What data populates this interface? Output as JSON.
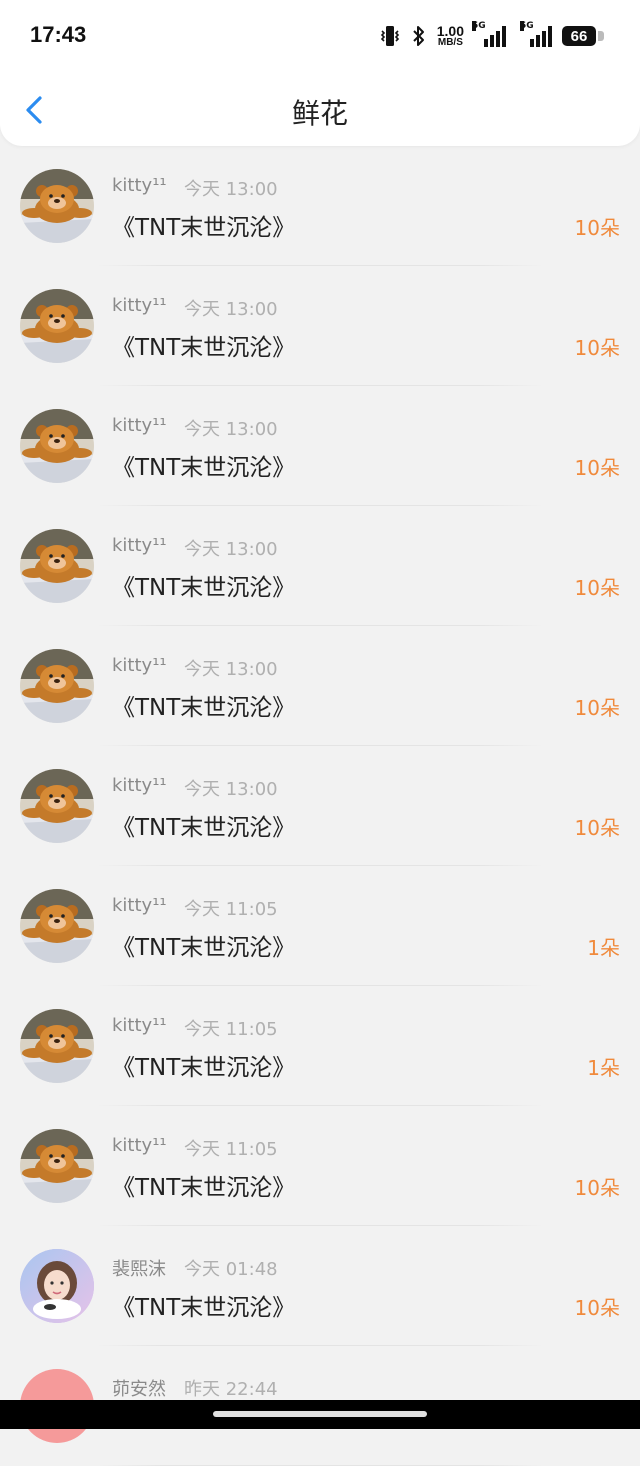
{
  "status_bar": {
    "time": "17:43",
    "speed_value": "1.00",
    "speed_unit": "MB/S",
    "net1": "5G",
    "net2": "5G",
    "battery": "66"
  },
  "header": {
    "title": "鲜花",
    "back_icon": "chevron-left-icon",
    "accent_color": "#2b8cf0"
  },
  "records": [
    {
      "name": "kitty¹¹",
      "time": "今天 13:00",
      "message": "《TNT末世沉沦》",
      "count": "10朵",
      "avatar": "bear"
    },
    {
      "name": "kitty¹¹",
      "time": "今天 13:00",
      "message": "《TNT末世沉沦》",
      "count": "10朵",
      "avatar": "bear"
    },
    {
      "name": "kitty¹¹",
      "time": "今天 13:00",
      "message": "《TNT末世沉沦》",
      "count": "10朵",
      "avatar": "bear"
    },
    {
      "name": "kitty¹¹",
      "time": "今天 13:00",
      "message": "《TNT末世沉沦》",
      "count": "10朵",
      "avatar": "bear"
    },
    {
      "name": "kitty¹¹",
      "time": "今天 13:00",
      "message": "《TNT末世沉沦》",
      "count": "10朵",
      "avatar": "bear"
    },
    {
      "name": "kitty¹¹",
      "time": "今天 13:00",
      "message": "《TNT末世沉沦》",
      "count": "10朵",
      "avatar": "bear"
    },
    {
      "name": "kitty¹¹",
      "time": "今天 11:05",
      "message": "《TNT末世沉沦》",
      "count": "1朵",
      "avatar": "bear"
    },
    {
      "name": "kitty¹¹",
      "time": "今天 11:05",
      "message": "《TNT末世沉沦》",
      "count": "1朵",
      "avatar": "bear"
    },
    {
      "name": "kitty¹¹",
      "time": "今天 11:05",
      "message": "《TNT末世沉沦》",
      "count": "10朵",
      "avatar": "bear"
    },
    {
      "name": "裴熙沫",
      "time": "今天 01:48",
      "message": "《TNT末世沉沦》",
      "count": "10朵",
      "avatar": "girl"
    },
    {
      "name": "茆安然",
      "time": "昨天 22:44",
      "message": "",
      "count": "",
      "avatar": "pink"
    }
  ],
  "colors": {
    "count_color": "#f08a3c",
    "name_color": "#8a8a8a",
    "time_color": "#b0b0b0"
  }
}
